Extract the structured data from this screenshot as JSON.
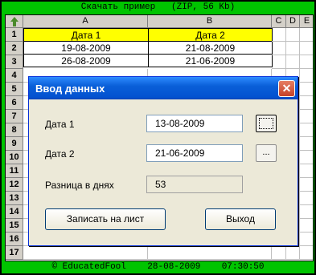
{
  "top_caption": "Скачать пример   (ZIP, 56 Kb)",
  "bottom_caption": "© EducatedFool    28-08-2009    07:30:50",
  "sheet": {
    "columns": [
      "A",
      "B",
      "C",
      "D",
      "E"
    ],
    "rows": [
      "1",
      "2",
      "3",
      "4",
      "5",
      "6",
      "7",
      "8",
      "9",
      "10",
      "11",
      "12",
      "13",
      "14",
      "15",
      "16",
      "17"
    ],
    "header": [
      "Дата 1",
      "Дата 2"
    ],
    "data": [
      [
        "19-08-2009",
        "21-08-2009"
      ],
      [
        "26-08-2009",
        "21-06-2009"
      ]
    ]
  },
  "dialog": {
    "title": "Ввод данных",
    "close_label": "✕",
    "date1_label": "Дата 1",
    "date1_value": "13-08-2009",
    "date1_button": "...",
    "date2_label": "Дата 2",
    "date2_value": "21-06-2009",
    "date2_button": "...",
    "diff_label": "Разница в днях",
    "diff_value": "53",
    "write_button": "Записать на лист",
    "exit_button": "Выход"
  },
  "colors": {
    "frame": "#00c400",
    "header_fill": "#ffff00",
    "titlebar": "#0a5fd8"
  }
}
